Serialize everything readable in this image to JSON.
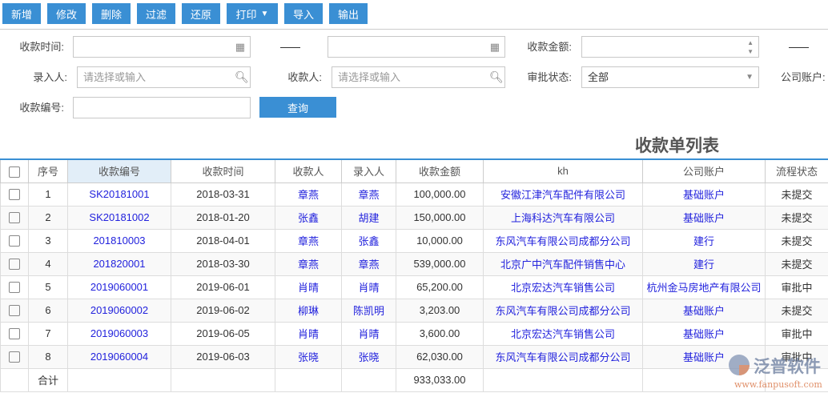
{
  "toolbar": {
    "add": "新增",
    "edit": "修改",
    "delete": "删除",
    "filter": "过滤",
    "restore": "还原",
    "print": "打印",
    "import": "导入",
    "export": "输出"
  },
  "filters": {
    "time_label": "收款时间:",
    "amount_label": "收款金额:",
    "entry_label": "录入人:",
    "entry_placeholder": "请选择或输入",
    "payee_label": "收款人:",
    "payee_placeholder": "请选择或输入",
    "status_label": "审批状态:",
    "status_value": "全部",
    "account_label": "公司账户:",
    "code_label": "收款编号:",
    "query": "查询"
  },
  "table": {
    "title": "收款单列表",
    "headers": [
      "序号",
      "收款编号",
      "收款时间",
      "收款人",
      "录入人",
      "收款金额",
      "kh",
      "公司账户",
      "流程状态"
    ],
    "rows": [
      [
        "1",
        "SK20181001",
        "2018-03-31",
        "章燕",
        "章燕",
        "100,000.00",
        "安徽江津汽车配件有限公司",
        "基础账户",
        "未提交"
      ],
      [
        "2",
        "SK20181002",
        "2018-01-20",
        "张鑫",
        "胡建",
        "150,000.00",
        "上海科达汽车有限公司",
        "基础账户",
        "未提交"
      ],
      [
        "3",
        "201810003",
        "2018-04-01",
        "章燕",
        "张鑫",
        "10,000.00",
        "东风汽车有限公司成都分公司",
        "建行",
        "未提交"
      ],
      [
        "4",
        "201820001",
        "2018-03-30",
        "章燕",
        "章燕",
        "539,000.00",
        "北京广中汽车配件销售中心",
        "建行",
        "未提交"
      ],
      [
        "5",
        "2019060001",
        "2019-06-01",
        "肖晴",
        "肖晴",
        "65,200.00",
        "北京宏达汽车销售公司",
        "杭州金马房地产有限公司",
        "审批中"
      ],
      [
        "6",
        "2019060002",
        "2019-06-02",
        "柳琳",
        "陈凯明",
        "3,203.00",
        "东风汽车有限公司成都分公司",
        "基础账户",
        "未提交"
      ],
      [
        "7",
        "2019060003",
        "2019-06-05",
        "肖晴",
        "肖晴",
        "3,600.00",
        "北京宏达汽车销售公司",
        "基础账户",
        "审批中"
      ],
      [
        "8",
        "2019060004",
        "2019-06-03",
        "张晓",
        "张晓",
        "62,030.00",
        "东风汽车有限公司成都分公司",
        "基础账户",
        "审批中"
      ]
    ],
    "total_label": "合计",
    "total_amount": "933,033.00"
  },
  "watermark": {
    "name": "泛普软件",
    "url": "www.fanpusoft.com"
  }
}
